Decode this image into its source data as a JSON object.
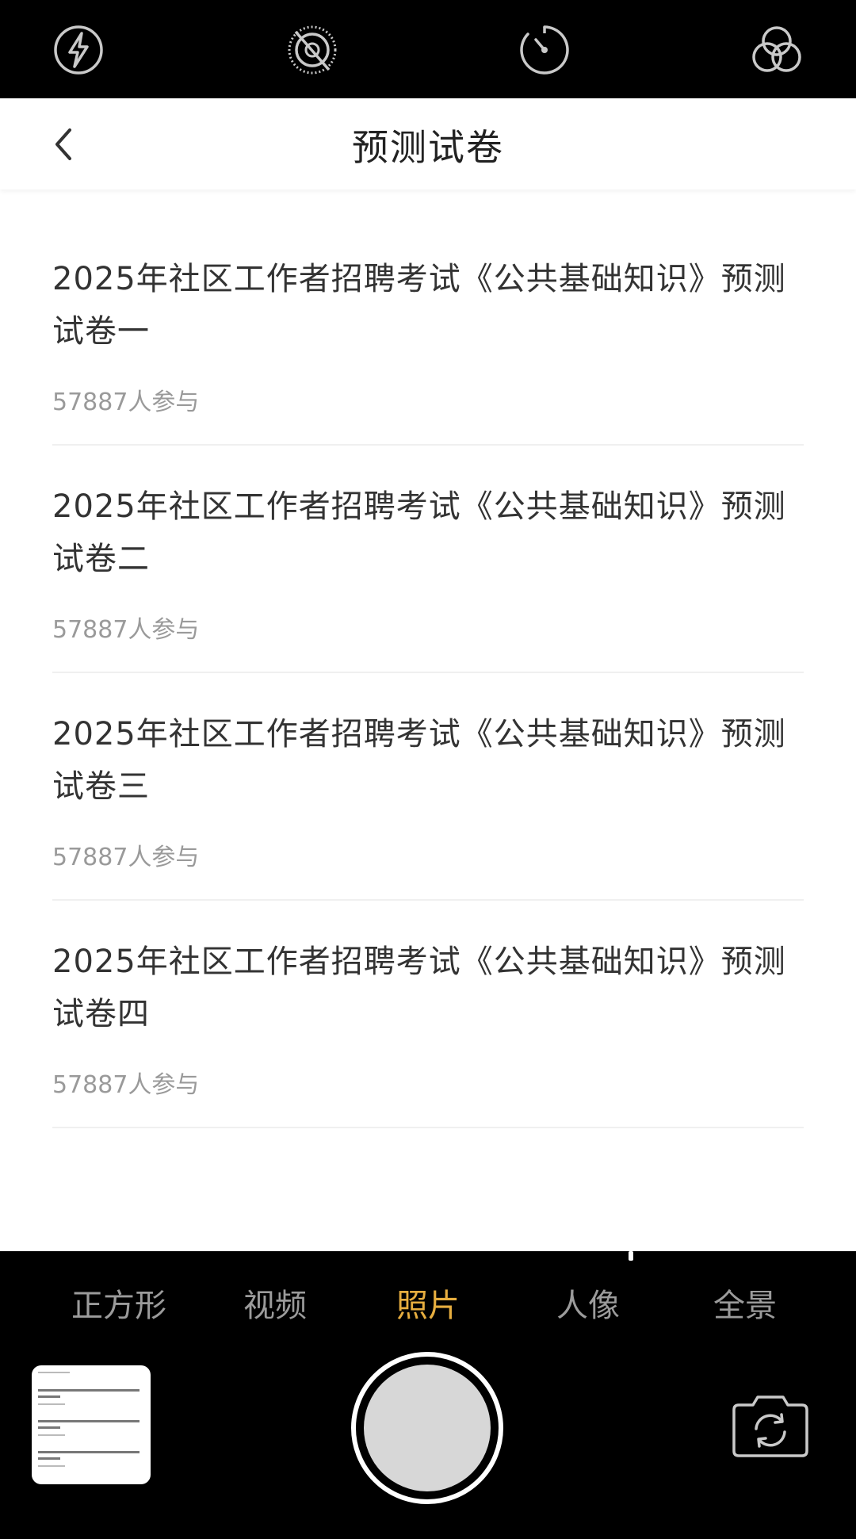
{
  "camera": {
    "top_icons": [
      "flash-icon",
      "live-photo-off-icon",
      "timer-icon",
      "filters-icon"
    ],
    "modes": [
      {
        "label": "正方形",
        "active": false
      },
      {
        "label": "视频",
        "active": false
      },
      {
        "label": "照片",
        "active": true
      },
      {
        "label": "人像",
        "active": false
      },
      {
        "label": "全景",
        "active": false
      }
    ],
    "active_color": "#e7ae3f"
  },
  "app": {
    "title": "预测试卷",
    "items": [
      {
        "title": "2025年社区工作者招聘考试《公共基础知识》预测试卷一",
        "meta": "57887人参与"
      },
      {
        "title": "2025年社区工作者招聘考试《公共基础知识》预测试卷二",
        "meta": "57887人参与"
      },
      {
        "title": "2025年社区工作者招聘考试《公共基础知识》预测试卷三",
        "meta": "57887人参与"
      },
      {
        "title": "2025年社区工作者招聘考试《公共基础知识》预测试卷四",
        "meta": "57887人参与"
      }
    ]
  }
}
